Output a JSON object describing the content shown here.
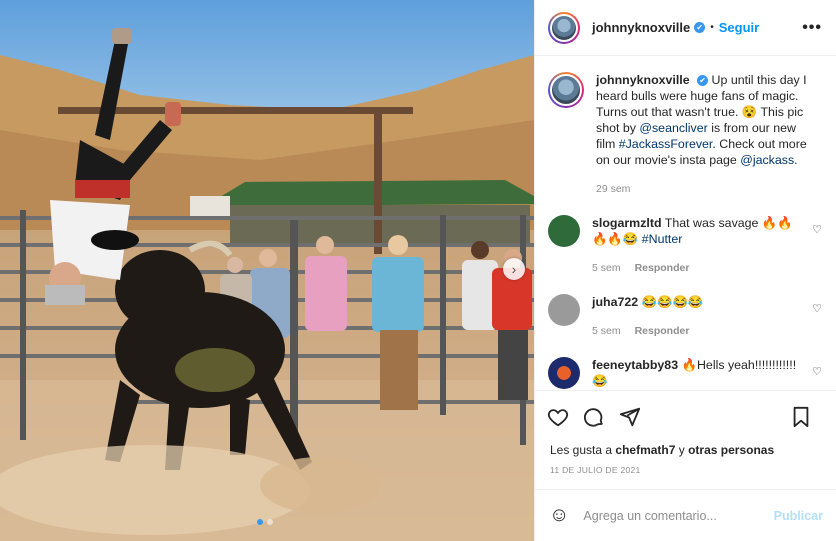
{
  "post": {
    "username": "johnnyknoxville",
    "verified_mark": "✔",
    "separator": "•",
    "follow_label": "Seguir",
    "more_icon": "•••",
    "next_icon": "›"
  },
  "caption": {
    "username": "johnnyknoxville",
    "text_1": "Up until this day I heard bulls were huge fans of magic. Turns out that wasn't true. 😵 This pic shot by ",
    "mention_1": "@seancliver",
    "text_2": " is from our new film ",
    "hashtag": "#JackassForever",
    "text_3": ". Check out more on our movie's insta page ",
    "mention_2": "@jackass",
    "text_4": ".",
    "time": "29 sem"
  },
  "comments": [
    {
      "username": "slogarmzltd",
      "text": "That was savage 🔥🔥🔥🔥😂 ",
      "hashtag": "#Nutter",
      "time": "5 sem",
      "reply_label": "Responder",
      "heart": "♡",
      "avatar_color": "#2f6b3a"
    },
    {
      "username": "juha722",
      "text": "😂😂😂😂",
      "time": "5 sem",
      "reply_label": "Responder",
      "heart": "♡",
      "avatar_color": "#9a9a9a"
    },
    {
      "username": "feeneytabby83",
      "text": "🔥Hells yeah!!!!!!!!!!!! 😂",
      "heart": "♡",
      "avatar_color": "#1d2a6b"
    }
  ],
  "actions": {
    "like_icon": "heart-icon",
    "comment_icon": "comment-icon",
    "share_icon": "share-icon",
    "save_icon": "bookmark-icon"
  },
  "likes": {
    "prefix": "Les gusta a ",
    "user": "chefmath7",
    "middle": " y ",
    "others": "otras personas"
  },
  "date": "11 DE JULIO DE 2021",
  "add_comment": {
    "emoji_icon": "☺",
    "placeholder": "Agrega un comentario...",
    "publish_label": "Publicar"
  },
  "colors": {
    "accent": "#0095f6",
    "muted": "#8e8e8e",
    "link": "#00376b",
    "publish_disabled": "#b2dffc"
  },
  "carousel": {
    "slides": 2,
    "active": 1
  }
}
